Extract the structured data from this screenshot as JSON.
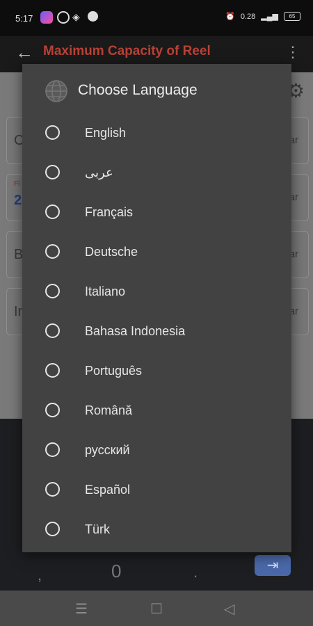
{
  "status_bar": {
    "time": "5:17",
    "net_speed": "0.28",
    "battery": "65"
  },
  "toolbar": {
    "title": "Maximum Capacity of Reel"
  },
  "background": {
    "card1_initial": "C",
    "card1_unit": "ar",
    "card2_label": "Fl",
    "card2_value": "2",
    "card2_unit": "ar",
    "card3_initial": "B",
    "card3_unit": "ar",
    "card4_initial": "In",
    "card4_unit": "ar"
  },
  "keyboard": {
    "key_comma": ",",
    "key_zero": "0",
    "key_dot": ".",
    "key_tab": "⇥"
  },
  "dialog": {
    "title": "Choose Language",
    "options": [
      {
        "label": "English"
      },
      {
        "label": "عربى"
      },
      {
        "label": "Français"
      },
      {
        "label": "Deutsche"
      },
      {
        "label": "Italiano"
      },
      {
        "label": "Bahasa Indonesia"
      },
      {
        "label": "Português"
      },
      {
        "label": "Română"
      },
      {
        "label": "русский"
      },
      {
        "label": "Español"
      },
      {
        "label": "Türk"
      }
    ]
  },
  "colors": {
    "title_accent": "#b84236",
    "dialog_bg": "#424242",
    "keyboard_accent": "#4a68a8"
  }
}
